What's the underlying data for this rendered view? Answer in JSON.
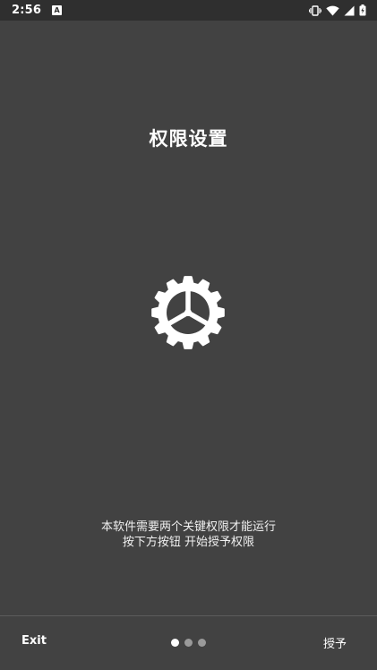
{
  "status_bar": {
    "time": "2:56",
    "app_icon": "app-notification-icon",
    "app_icon_letter": "A",
    "icons": [
      "vibrate-icon",
      "wifi-icon",
      "cellular-signal-icon",
      "battery-charging-icon"
    ]
  },
  "main": {
    "title": "权限设置",
    "gear_icon": "gear-icon",
    "description_line1": "本软件需要两个关键权限才能运行",
    "description_line2": "按下方按钮 开始授予权限"
  },
  "bottom_bar": {
    "exit_label": "Exit",
    "grant_label": "授予",
    "page_count": 3,
    "active_page": 1
  },
  "colors": {
    "background": "#424242",
    "status_bar": "#2f2f2f",
    "text": "#ffffff",
    "dot_inactive": "#9a9a9a",
    "divider": "#5c5c5c"
  }
}
